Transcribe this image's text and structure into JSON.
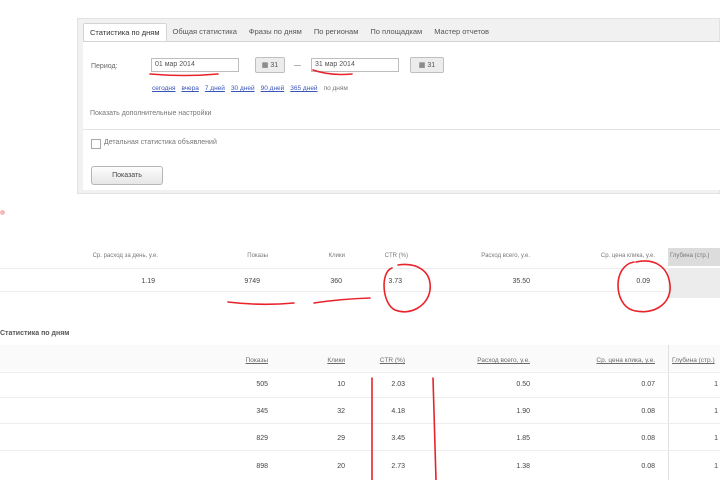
{
  "tabs": [
    {
      "label": "Статистика по дням",
      "active": true
    },
    {
      "label": "Общая статистика",
      "active": false
    },
    {
      "label": "Фразы по дням",
      "active": false
    },
    {
      "label": "По регионам",
      "active": false
    },
    {
      "label": "По площадкам",
      "active": false
    },
    {
      "label": "Мастер отчетов",
      "active": false
    }
  ],
  "period": {
    "label": "Период:",
    "from": "01 мар 2014",
    "to": "31 мар 2014",
    "separator": "—",
    "cal_label": "31"
  },
  "quick_links": [
    "сегодня",
    "вчера",
    "7 дней",
    "30 дней",
    "90 дней",
    "365 дней"
  ],
  "quick_links_tail": "по дням",
  "advanced_settings": "Показать дополнительные настройки",
  "detail_checkbox": {
    "label": "Детальная статистика объявлений",
    "checked": false
  },
  "show_button": "Показать",
  "summary": {
    "headers": [
      "Ср. расход за день, у.е.",
      "Показы",
      "Клики",
      "CTR (%)",
      "Расход всего, у.е.",
      "Ср. цена клика, у.е.",
      "Глубина (стр.)"
    ],
    "values": [
      "1.19",
      "9749",
      "360",
      "3.73",
      "35.50",
      "0.09",
      ""
    ]
  },
  "section_title": "Статистика по дням",
  "detail": {
    "headers": [
      "Показы",
      "Клики",
      "CTR (%)",
      "Расход всего, у.е.",
      "Ср. цена клика, у.е.",
      "Глубина (стр.)"
    ],
    "rows": [
      [
        "505",
        "10",
        "2.03",
        "0.50",
        "0.07",
        "1"
      ],
      [
        "345",
        "32",
        "4.18",
        "1.90",
        "0.08",
        "1"
      ],
      [
        "829",
        "29",
        "3.45",
        "1.85",
        "0.08",
        "1"
      ],
      [
        "898",
        "20",
        "2.73",
        "1.38",
        "0.08",
        "1"
      ]
    ]
  },
  "colors": {
    "accent_link": "#3a55b8",
    "annotation_red": "#e8232a"
  }
}
